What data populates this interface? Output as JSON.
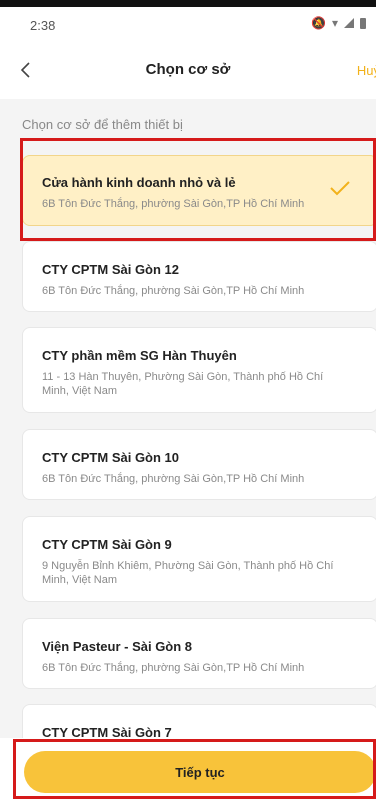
{
  "status": {
    "time": "2:38"
  },
  "nav": {
    "title": "Chọn cơ sở",
    "cancel_label": "Huỷ"
  },
  "subtitle": "Chọn cơ sở để thêm thiết bị",
  "locations": [
    {
      "name": "Cửa hành kinh doanh nhỏ và lẻ",
      "address": "6B Tôn Đức Thắng, phường Sài Gòn,TP Hồ Chí Minh",
      "selected": true
    },
    {
      "name": "CTY CPTM Sài Gòn 12",
      "address": "6B Tôn Đức Thắng, phường Sài Gòn,TP Hồ Chí Minh",
      "selected": false
    },
    {
      "name": "CTY phần mềm SG Hàn Thuyên",
      "address": "11 - 13 Hàn Thuyên, Phường Sài Gòn, Thành phố Hồ Chí Minh, Việt Nam",
      "selected": false
    },
    {
      "name": "CTY CPTM Sài Gòn 10",
      "address": "6B Tôn Đức Thắng, phường Sài Gòn,TP Hồ Chí Minh",
      "selected": false
    },
    {
      "name": "CTY CPTM Sài Gòn 9",
      "address": "9 Nguyễn Bỉnh Khiêm, Phường Sài Gòn, Thành phố Hồ Chí Minh, Việt Nam",
      "selected": false
    },
    {
      "name": "Viện Pasteur - Sài Gòn 8",
      "address": "6B Tôn Đức Thắng, phường Sài Gòn,TP Hồ Chí Minh",
      "selected": false
    },
    {
      "name": "CTY CPTM Sài Gòn 7",
      "address": "",
      "selected": false
    }
  ],
  "actions": {
    "continue_label": "Tiếp tục"
  },
  "colors": {
    "accent": "#f8c33a",
    "selected_bg": "#fff0c6",
    "highlight": "#d51a1a"
  }
}
